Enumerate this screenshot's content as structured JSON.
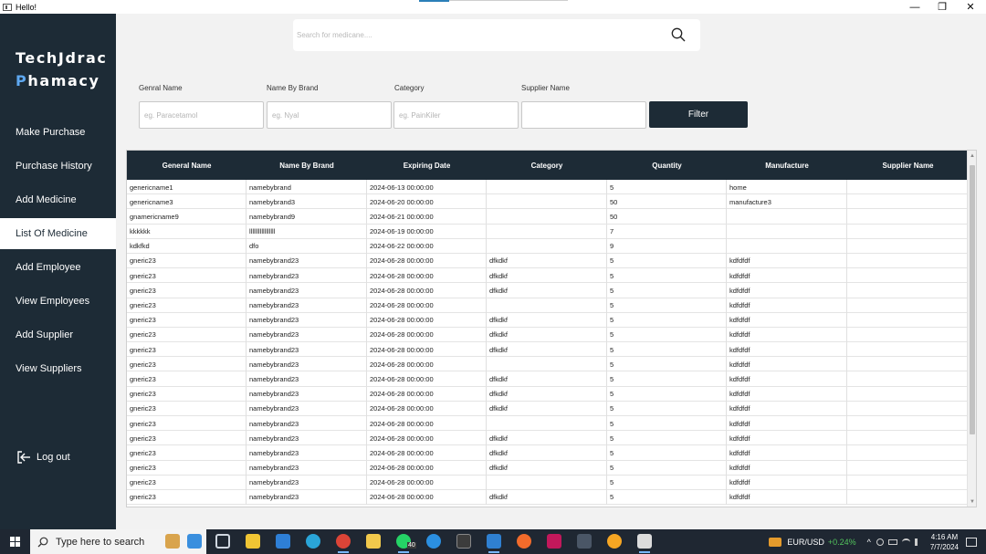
{
  "window": {
    "title": "Hello!",
    "controls": {
      "minimize": "—",
      "restore": "❐",
      "close": "✕"
    }
  },
  "sidebar": {
    "logo_line1": "TechJdrac",
    "logo_line2_accent": "P",
    "logo_line2_rest": "hamacy",
    "items": [
      {
        "label": "Make Purchase"
      },
      {
        "label": "Purchase History"
      },
      {
        "label": "Add Medicine"
      },
      {
        "label": "List Of Medicine",
        "active": true
      },
      {
        "label": "Add Employee"
      },
      {
        "label": "View Employees"
      },
      {
        "label": "Add Supplier"
      },
      {
        "label": "View Suppliers"
      }
    ],
    "logout_label": "Log out"
  },
  "search": {
    "placeholder": "Search for medicane....",
    "value": ""
  },
  "filters": {
    "general_name": {
      "label": "Genral Name",
      "placeholder": "eg. Paracetamol",
      "value": ""
    },
    "brand_name": {
      "label": "Name By Brand",
      "placeholder": "eg. Nyal",
      "value": ""
    },
    "category": {
      "label": "Category",
      "placeholder": "eg. PainKiler",
      "value": ""
    },
    "supplier": {
      "label": "Supplier Name",
      "placeholder": "",
      "value": ""
    },
    "button_label": "Filter"
  },
  "table": {
    "columns": [
      "General Name",
      "Name By Brand",
      "Expiring Date",
      "Category",
      "Quantity",
      "Manufacture",
      "Supplier Name"
    ],
    "rows": [
      [
        "genericname1",
        "namebybrand",
        "2024-06-13 00:00:00",
        "",
        "5",
        "home",
        ""
      ],
      [
        "genericname3",
        "namebybrand3",
        "2024-06-20 00:00:00",
        "",
        "50",
        "manufacture3",
        ""
      ],
      [
        "gnamericname9",
        "namebybrand9",
        "2024-06-21 00:00:00",
        "",
        "50",
        "",
        ""
      ],
      [
        "kkkkkk",
        "lllllllllllllllll",
        "2024-06-19 00:00:00",
        "",
        "7",
        "",
        ""
      ],
      [
        "kdkfkd",
        "dfo",
        "2024-06-22 00:00:00",
        "",
        "9",
        "",
        ""
      ],
      [
        "gneric23",
        "namebybrand23",
        "2024-06-28 00:00:00",
        "dfkdkf",
        "5",
        "kdfdfdf",
        ""
      ],
      [
        "gneric23",
        "namebybrand23",
        "2024-06-28 00:00:00",
        "dfkdkf",
        "5",
        "kdfdfdf",
        ""
      ],
      [
        "gneric23",
        "namebybrand23",
        "2024-06-28 00:00:00",
        "dfkdkf",
        "5",
        "kdfdfdf",
        ""
      ],
      [
        "gneric23",
        "namebybrand23",
        "2024-06-28 00:00:00",
        "",
        "5",
        "kdfdfdf",
        ""
      ],
      [
        "gneric23",
        "namebybrand23",
        "2024-06-28 00:00:00",
        "dfkdkf",
        "5",
        "kdfdfdf",
        ""
      ],
      [
        "gneric23",
        "namebybrand23",
        "2024-06-28 00:00:00",
        "dfkdkf",
        "5",
        "kdfdfdf",
        ""
      ],
      [
        "gneric23",
        "namebybrand23",
        "2024-06-28 00:00:00",
        "dfkdkf",
        "5",
        "kdfdfdf",
        ""
      ],
      [
        "gneric23",
        "namebybrand23",
        "2024-06-28 00:00:00",
        "",
        "5",
        "kdfdfdf",
        ""
      ],
      [
        "gneric23",
        "namebybrand23",
        "2024-06-28 00:00:00",
        "dfkdkf",
        "5",
        "kdfdfdf",
        ""
      ],
      [
        "gneric23",
        "namebybrand23",
        "2024-06-28 00:00:00",
        "dfkdkf",
        "5",
        "kdfdfdf",
        ""
      ],
      [
        "gneric23",
        "namebybrand23",
        "2024-06-28 00:00:00",
        "dfkdkf",
        "5",
        "kdfdfdf",
        ""
      ],
      [
        "gneric23",
        "namebybrand23",
        "2024-06-28 00:00:00",
        "",
        "5",
        "kdfdfdf",
        ""
      ],
      [
        "gneric23",
        "namebybrand23",
        "2024-06-28 00:00:00",
        "dfkdkf",
        "5",
        "kdfdfdf",
        ""
      ],
      [
        "gneric23",
        "namebybrand23",
        "2024-06-28 00:00:00",
        "dfkdkf",
        "5",
        "kdfdfdf",
        ""
      ],
      [
        "gneric23",
        "namebybrand23",
        "2024-06-28 00:00:00",
        "dfkdkf",
        "5",
        "kdfdfdf",
        ""
      ],
      [
        "gneric23",
        "namebybrand23",
        "2024-06-28 00:00:00",
        "",
        "5",
        "kdfdfdf",
        ""
      ],
      [
        "gneric23",
        "namebybrand23",
        "2024-06-28 00:00:00",
        "dfkdkf",
        "5",
        "kdfdfdf",
        ""
      ]
    ]
  },
  "taskbar": {
    "search_placeholder": "Type here to search",
    "whatsapp_badge": "40",
    "ticker_pair": "EUR/USD",
    "ticker_change": "+0.24%",
    "time": "4:16 AM",
    "date": "7/7/2024",
    "colors": {
      "accent": "#1d2b36",
      "logo_accent": "#5ea8f0"
    }
  }
}
